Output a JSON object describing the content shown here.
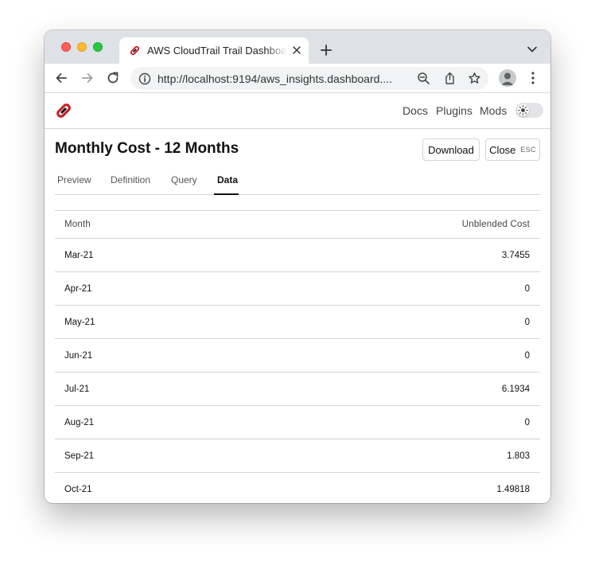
{
  "browser": {
    "tab_title": "AWS CloudTrail Trail Dashboard",
    "url": "http://localhost:9194/aws_insights.dashboard...."
  },
  "app": {
    "nav": {
      "docs": "Docs",
      "plugins": "Plugins",
      "mods": "Mods"
    }
  },
  "panel": {
    "title": "Monthly Cost - 12 Months",
    "download_label": "Download",
    "close_label": "Close",
    "close_shortcut": "ESC",
    "tabs": [
      {
        "label": "Preview"
      },
      {
        "label": "Definition"
      },
      {
        "label": "Query"
      },
      {
        "label": "Data"
      }
    ],
    "active_tab": "Data"
  },
  "table": {
    "columns": [
      "Month",
      "Unblended Cost"
    ],
    "rows": [
      {
        "month": "Mar-21",
        "cost": "3.7455"
      },
      {
        "month": "Apr-21",
        "cost": "0"
      },
      {
        "month": "May-21",
        "cost": "0"
      },
      {
        "month": "Jun-21",
        "cost": "0"
      },
      {
        "month": "Jul-21",
        "cost": "6.1934"
      },
      {
        "month": "Aug-21",
        "cost": "0"
      },
      {
        "month": "Sep-21",
        "cost": "1.803"
      },
      {
        "month": "Oct-21",
        "cost": "1.49818"
      }
    ]
  },
  "colors": {
    "logo_red": "#c72026",
    "logo_dark": "#1a1a1a",
    "tabstrip": "#dee1e6",
    "border": "#d4d4d4"
  },
  "icons": {
    "tab": [
      "steampipe-favicon",
      "close-icon",
      "plus-icon",
      "chevron-down-icon"
    ],
    "toolbar": [
      "back-arrow-icon",
      "forward-arrow-icon",
      "reload-icon",
      "info-icon",
      "zoom-out-icon",
      "share-icon",
      "star-icon",
      "profile-icon",
      "kebab-menu-icon"
    ],
    "app": [
      "steampipe-logo",
      "sun-icon"
    ]
  }
}
